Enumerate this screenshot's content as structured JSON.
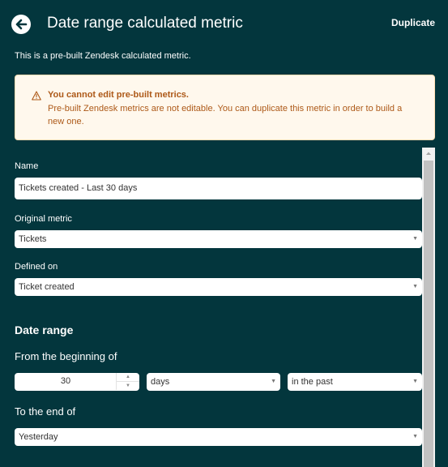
{
  "header": {
    "title": "Date range calculated metric",
    "duplicate_label": "Duplicate"
  },
  "subtitle": "This is a pre-built Zendesk calculated metric.",
  "alert": {
    "title": "You cannot edit pre-built metrics.",
    "body": "Pre-built Zendesk metrics are not editable. You can duplicate this metric in order to build a new one.",
    "icon": "warning-icon",
    "color": "#ad5918",
    "background": "#fff8ed"
  },
  "form": {
    "name_label": "Name",
    "name_value": "Tickets created - Last 30 days",
    "original_metric_label": "Original metric",
    "original_metric_value": "Tickets",
    "defined_on_label": "Defined on",
    "defined_on_value": "Ticket created",
    "date_range_title": "Date range",
    "from_label": "From the beginning of",
    "from_amount": "30",
    "from_unit": "days",
    "from_direction": "in the past",
    "to_label": "To the end of",
    "to_value": "Yesterday"
  },
  "colors": {
    "background": "#03363d",
    "field": "#ffffff",
    "scrollbar_track": "#f1f1f1",
    "scrollbar_thumb": "#c1c1c1"
  }
}
